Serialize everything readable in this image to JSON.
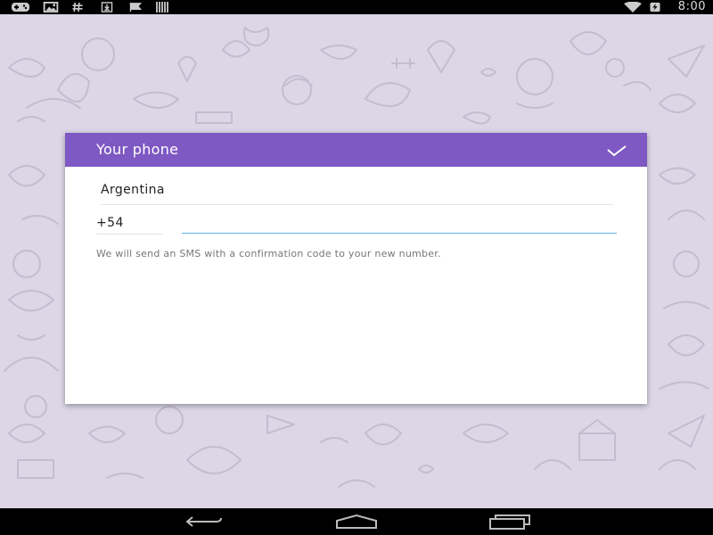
{
  "status_bar": {
    "time": "8:00",
    "left_icons": [
      "gamepad-icon",
      "image-icon",
      "hashtag-icon",
      "download-icon",
      "flag-icon",
      "barcode-icon"
    ],
    "right_icons": [
      "wifi-icon",
      "battery-charging-icon"
    ]
  },
  "dialog": {
    "title": "Your phone",
    "confirm_icon": "checkmark-icon",
    "country": "Argentina",
    "country_code": "+54",
    "phone_value": "",
    "note": "We will send an SMS with a confirmation code to your new number.",
    "accent_color": "#7e58c3",
    "input_focus_color": "#5fb3e3"
  },
  "nav_bar": {
    "buttons": [
      "back-icon",
      "home-icon",
      "recents-icon"
    ]
  }
}
